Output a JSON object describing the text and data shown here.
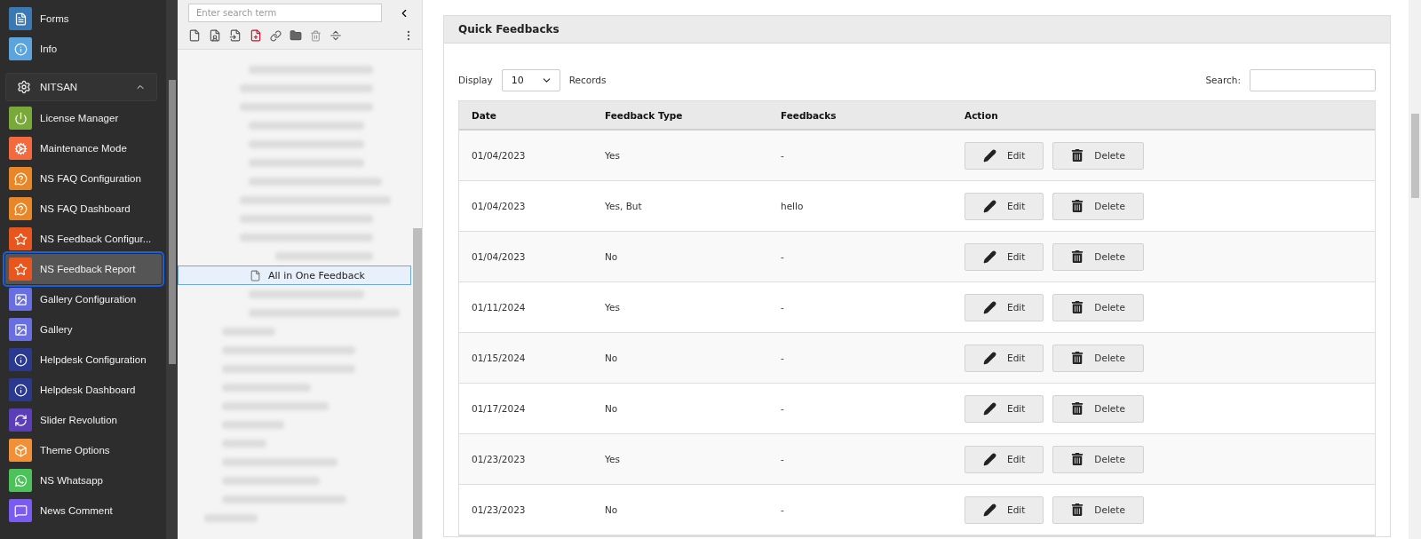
{
  "sidebar": {
    "items": [
      {
        "label": "Forms",
        "color": "#3a79b4",
        "selected": false
      },
      {
        "label": "Info",
        "color": "#5da4dc",
        "selected": false
      }
    ],
    "group": {
      "label": "NITSAN",
      "expanded": true
    },
    "group_items": [
      {
        "label": "License Manager",
        "color": "#79a83b",
        "selected": false
      },
      {
        "label": "Maintenance Mode",
        "color": "#f26a3d",
        "selected": false
      },
      {
        "label": "NS FAQ Configuration",
        "color": "#e8862a",
        "selected": false
      },
      {
        "label": "NS FAQ Dashboard",
        "color": "#e8862a",
        "selected": false
      },
      {
        "label": "NS Feedback Configur...",
        "color": "#e8561f",
        "selected": false
      },
      {
        "label": "NS Feedback Report",
        "color": "#e8561f",
        "selected": true
      },
      {
        "label": "Gallery Configuration",
        "color": "#6a6fe0",
        "selected": false
      },
      {
        "label": "Gallery",
        "color": "#6a6fe0",
        "selected": false
      },
      {
        "label": "Helpdesk Configuration",
        "color": "#2b3a8f",
        "selected": false
      },
      {
        "label": "Helpdesk Dashboard",
        "color": "#2b3a8f",
        "selected": false
      },
      {
        "label": "Slider Revolution",
        "color": "#5b3fb8",
        "selected": false
      },
      {
        "label": "Theme Options",
        "color": "#f0913a",
        "selected": false
      },
      {
        "label": "NS Whatsapp",
        "color": "#4dc25a",
        "selected": false
      },
      {
        "label": "News Comment",
        "color": "#7b5cf0",
        "selected": false
      }
    ]
  },
  "tree": {
    "search": {
      "placeholder": "Enter search term"
    },
    "items": [
      {
        "label": "All in One Feedback",
        "selected": true
      }
    ]
  },
  "panel": {
    "title": "Quick Feedbacks",
    "display_label": "Display",
    "page_size": "10",
    "records_label": "Records",
    "search_label": "Search:",
    "columns": [
      "Date",
      "Feedback Type",
      "Feedbacks",
      "Action"
    ],
    "rows": [
      {
        "date": "01/04/2023",
        "type": "Yes",
        "feedback": "-",
        "actions": [
          "Edit",
          "Delete"
        ]
      },
      {
        "date": "01/04/2023",
        "type": "Yes, But",
        "feedback": "hello",
        "actions": [
          "Edit",
          "Delete"
        ]
      },
      {
        "date": "01/04/2023",
        "type": "No",
        "feedback": "-",
        "actions": [
          "Edit",
          "Delete"
        ]
      },
      {
        "date": "01/11/2024",
        "type": "Yes",
        "feedback": "-",
        "actions": [
          "Edit",
          "Delete"
        ]
      },
      {
        "date": "01/15/2024",
        "type": "No",
        "feedback": "-",
        "actions": [
          "Edit",
          "Delete"
        ]
      },
      {
        "date": "01/17/2024",
        "type": "No",
        "feedback": "-",
        "actions": [
          "Edit",
          "Delete"
        ]
      },
      {
        "date": "01/23/2023",
        "type": "Yes",
        "feedback": "-",
        "actions": [
          "Edit",
          "Delete"
        ]
      },
      {
        "date": "01/23/2023",
        "type": "No",
        "feedback": "-",
        "actions": [
          "Edit",
          "Delete"
        ]
      }
    ]
  }
}
